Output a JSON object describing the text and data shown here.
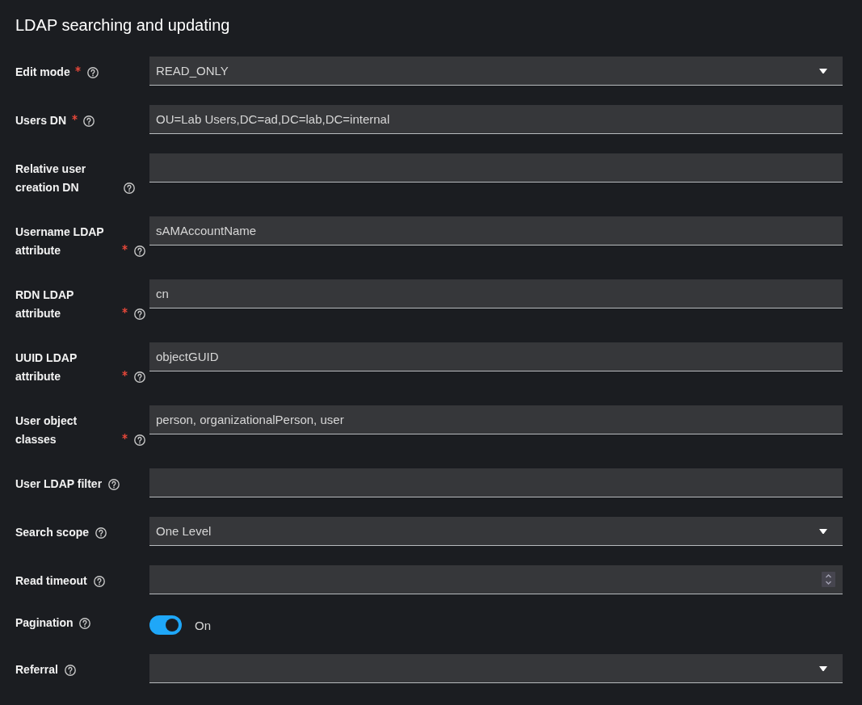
{
  "title": "LDAP searching and updating",
  "fields": [
    {
      "label": "Edit mode",
      "required": true,
      "kind": "select",
      "value": "READ_ONLY"
    },
    {
      "label": "Users DN",
      "required": true,
      "kind": "text",
      "value": "OU=Lab Users,DC=ad,DC=lab,DC=internal"
    },
    {
      "label": "Relative user creation DN",
      "required": false,
      "kind": "text"
    },
    {
      "label": "Username LDAP attribute",
      "required": true,
      "kind": "text",
      "value": "sAMAccountName"
    },
    {
      "label": "RDN LDAP attribute",
      "required": true,
      "kind": "text",
      "value": "cn"
    },
    {
      "label": "UUID LDAP attribute",
      "required": true,
      "kind": "text",
      "value": "objectGUID"
    },
    {
      "label": "User object classes",
      "required": true,
      "kind": "text",
      "value": "person, organizationalPerson, user"
    },
    {
      "label": "User LDAP filter",
      "required": false,
      "kind": "text"
    },
    {
      "label": "Search scope",
      "required": false,
      "kind": "select",
      "value": "One Level"
    },
    {
      "label": "Read timeout",
      "required": false,
      "kind": "number"
    },
    {
      "label": "Pagination",
      "required": false,
      "kind": "switch",
      "on": true,
      "state_label": "On"
    },
    {
      "label": "Referral",
      "required": false,
      "kind": "select"
    }
  ]
}
